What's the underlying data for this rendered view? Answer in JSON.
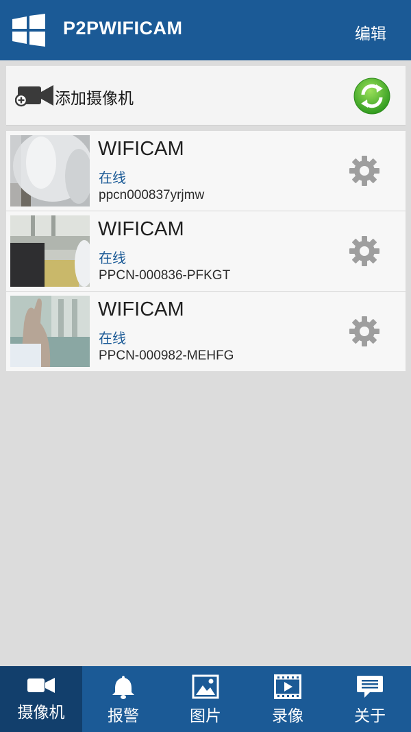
{
  "header": {
    "title": "P2PWIFICAM",
    "edit_label": "编辑",
    "background": "#1b5a96"
  },
  "add_camera": {
    "label": "添加摄像机",
    "icon": "video-camera-add-icon",
    "refresh_icon": "refresh-icon"
  },
  "cameras": [
    {
      "name": "WIFICAM",
      "status": "在线",
      "uid": "ppcn000837yrjmw"
    },
    {
      "name": "WIFICAM",
      "status": "在线",
      "uid": "PPCN-000836-PFKGT"
    },
    {
      "name": "WIFICAM",
      "status": "在线",
      "uid": "PPCN-000982-MEHFG"
    }
  ],
  "tabs": [
    {
      "label": "摄像机",
      "icon": "video-camera-icon",
      "active": true
    },
    {
      "label": "报警",
      "icon": "bell-icon",
      "active": false
    },
    {
      "label": "图片",
      "icon": "picture-icon",
      "active": false
    },
    {
      "label": "录像",
      "icon": "video-file-icon",
      "active": false
    },
    {
      "label": "关于",
      "icon": "message-icon",
      "active": false
    }
  ],
  "colors": {
    "primary": "#1b5a96",
    "active_tab": "#123f6c",
    "status_online": "#1b5a96",
    "refresh_green": "#4caf28"
  }
}
